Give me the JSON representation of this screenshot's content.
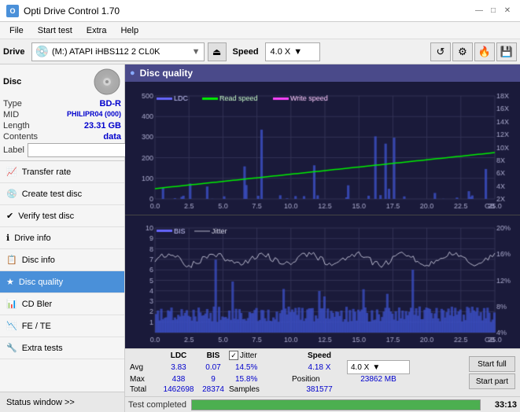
{
  "titlebar": {
    "title": "Opti Drive Control 1.70",
    "icon": "O",
    "minimize": "—",
    "maximize": "□",
    "close": "✕"
  },
  "menubar": {
    "items": [
      "File",
      "Start test",
      "Extra",
      "Help"
    ]
  },
  "drivebar": {
    "drive_label": "Drive",
    "drive_name": "(M:) ATAPI iHBS112  2 CL0K",
    "speed_label": "Speed",
    "speed_value": "4.0 X",
    "eject_icon": "⏏"
  },
  "disc": {
    "header": "Disc",
    "type_label": "Type",
    "type_value": "BD-R",
    "mid_label": "MID",
    "mid_value": "PHILIPR04 (000)",
    "length_label": "Length",
    "length_value": "23.31 GB",
    "contents_label": "Contents",
    "contents_value": "data",
    "label_label": "Label",
    "label_placeholder": ""
  },
  "nav": {
    "items": [
      {
        "id": "transfer-rate",
        "label": "Transfer rate",
        "icon": "📈"
      },
      {
        "id": "create-test-disc",
        "label": "Create test disc",
        "icon": "💿"
      },
      {
        "id": "verify-test-disc",
        "label": "Verify test disc",
        "icon": "✔"
      },
      {
        "id": "drive-info",
        "label": "Drive info",
        "icon": "ℹ"
      },
      {
        "id": "disc-info",
        "label": "Disc info",
        "icon": "📋"
      },
      {
        "id": "disc-quality",
        "label": "Disc quality",
        "icon": "★",
        "active": true
      },
      {
        "id": "cd-bler",
        "label": "CD Bler",
        "icon": "📊"
      },
      {
        "id": "fe-te",
        "label": "FE / TE",
        "icon": "📉"
      },
      {
        "id": "extra-tests",
        "label": "Extra tests",
        "icon": "🔧"
      }
    ],
    "status_window": "Status window >>"
  },
  "content": {
    "header": "Disc quality",
    "chart1": {
      "legend": [
        {
          "label": "LDC",
          "color": "#4444ff"
        },
        {
          "label": "Read speed",
          "color": "#00ff00"
        },
        {
          "label": "Write speed",
          "color": "#ff44ff"
        }
      ],
      "y_max": 500,
      "y_right_max": 18,
      "x_max": 25.0,
      "x_labels": [
        "0.0",
        "2.5",
        "5.0",
        "7.5",
        "10.0",
        "12.5",
        "15.0",
        "17.5",
        "20.0",
        "22.5",
        "25.0 GB"
      ],
      "y_left_labels": [
        "500",
        "400",
        "300",
        "200",
        "100"
      ],
      "y_right_labels": [
        "18X",
        "16X",
        "14X",
        "12X",
        "10X",
        "8X",
        "6X",
        "4X",
        "2X"
      ]
    },
    "chart2": {
      "legend": [
        {
          "label": "BIS",
          "color": "#4444ff"
        },
        {
          "label": "Jitter",
          "color": "#ffffff"
        }
      ],
      "y_max": 10,
      "y_right_max": 20,
      "x_max": 25.0,
      "x_labels": [
        "0.0",
        "2.5",
        "5.0",
        "7.5",
        "10.0",
        "12.5",
        "15.0",
        "17.5",
        "20.0",
        "22.5",
        "25.0 GB"
      ],
      "y_left_labels": [
        "10",
        "9",
        "8",
        "7",
        "6",
        "5",
        "4",
        "3",
        "2",
        "1"
      ],
      "y_right_labels": [
        "20%",
        "16%",
        "12%",
        "8%",
        "4%"
      ]
    }
  },
  "stats": {
    "headers": [
      "",
      "LDC",
      "BIS",
      "",
      "Jitter",
      "Speed",
      ""
    ],
    "avg_label": "Avg",
    "avg_ldc": "3.83",
    "avg_bis": "0.07",
    "avg_jitter": "14.5%",
    "avg_speed": "4.18 X",
    "speed_selector": "4.0 X",
    "max_label": "Max",
    "max_ldc": "438",
    "max_bis": "9",
    "max_jitter": "15.8%",
    "pos_label": "Position",
    "pos_value": "23862 MB",
    "total_label": "Total",
    "total_ldc": "1462698",
    "total_bis": "28374",
    "samples_label": "Samples",
    "samples_value": "381577",
    "start_full": "Start full",
    "start_part": "Start part",
    "jitter_checked": true
  },
  "progress": {
    "status_text": "Test completed",
    "percent": 100,
    "time": "33:13"
  }
}
